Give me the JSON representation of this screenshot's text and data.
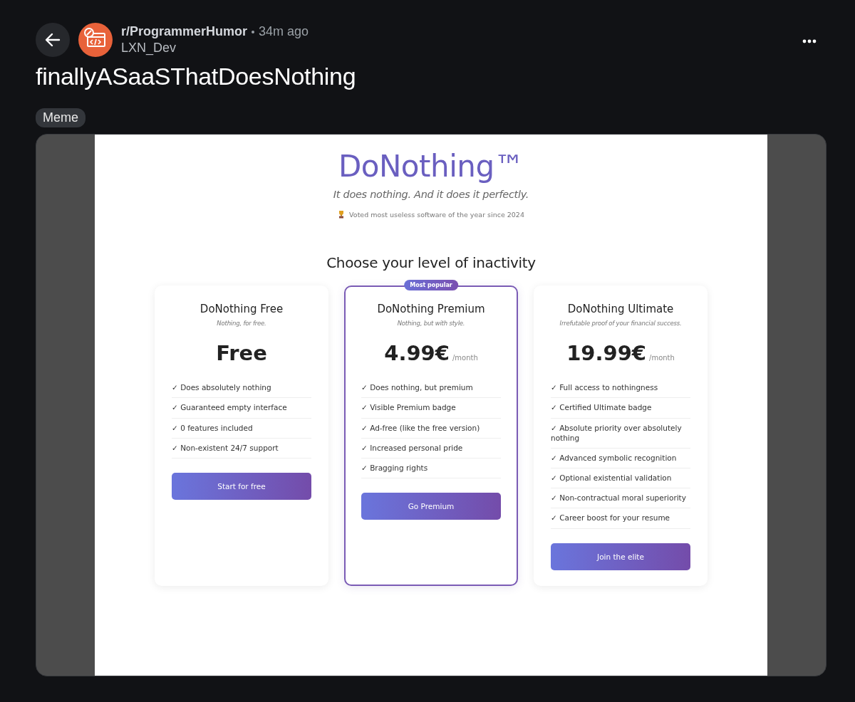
{
  "post": {
    "subreddit": "r/ProgrammerHumor",
    "time": "34m ago",
    "author": "LXN_Dev",
    "title": "finallyASaaSThatDoesNothing",
    "flair": "Meme"
  },
  "image": {
    "brand": "DoNothing™",
    "tagline": "It does nothing. And it does it perfectly.",
    "award": "Voted most useless software of the year since 2024",
    "heading": "Choose your level of inactivity",
    "plans": [
      {
        "name": "DoNothing Free",
        "subtitle": "Nothing, for free.",
        "price": "Free",
        "highlighted": false,
        "features": [
          "✓ Does absolutely nothing",
          "✓ Guaranteed empty interface",
          "✓ 0 features included",
          "✓ Non-existent 24/7 support"
        ],
        "button": "Start for free"
      },
      {
        "name": "DoNothing Premium",
        "subtitle": "Nothing, but with style.",
        "price": "4.99€",
        "period": "/month",
        "badge": "Most popular",
        "highlighted": true,
        "features": [
          "✓ Does nothing, but premium",
          "✓ Visible Premium badge",
          "✓ Ad-free (like the free version)",
          "✓ Increased personal pride",
          "✓ Bragging rights"
        ],
        "button": "Go Premium"
      },
      {
        "name": "DoNothing Ultimate",
        "subtitle": "Irrefutable proof of your financial success.",
        "price": "19.99€",
        "period": "/month",
        "highlighted": false,
        "features": [
          "✓ Full access to nothingness",
          "✓ Certified Ultimate badge",
          "✓ Absolute priority over absolutely nothing",
          "✓ Advanced symbolic recognition",
          "✓ Optional existential validation",
          "✓ Non-contractual moral superiority",
          "✓ Career boost for your resume"
        ],
        "button": "Join the elite"
      }
    ]
  }
}
